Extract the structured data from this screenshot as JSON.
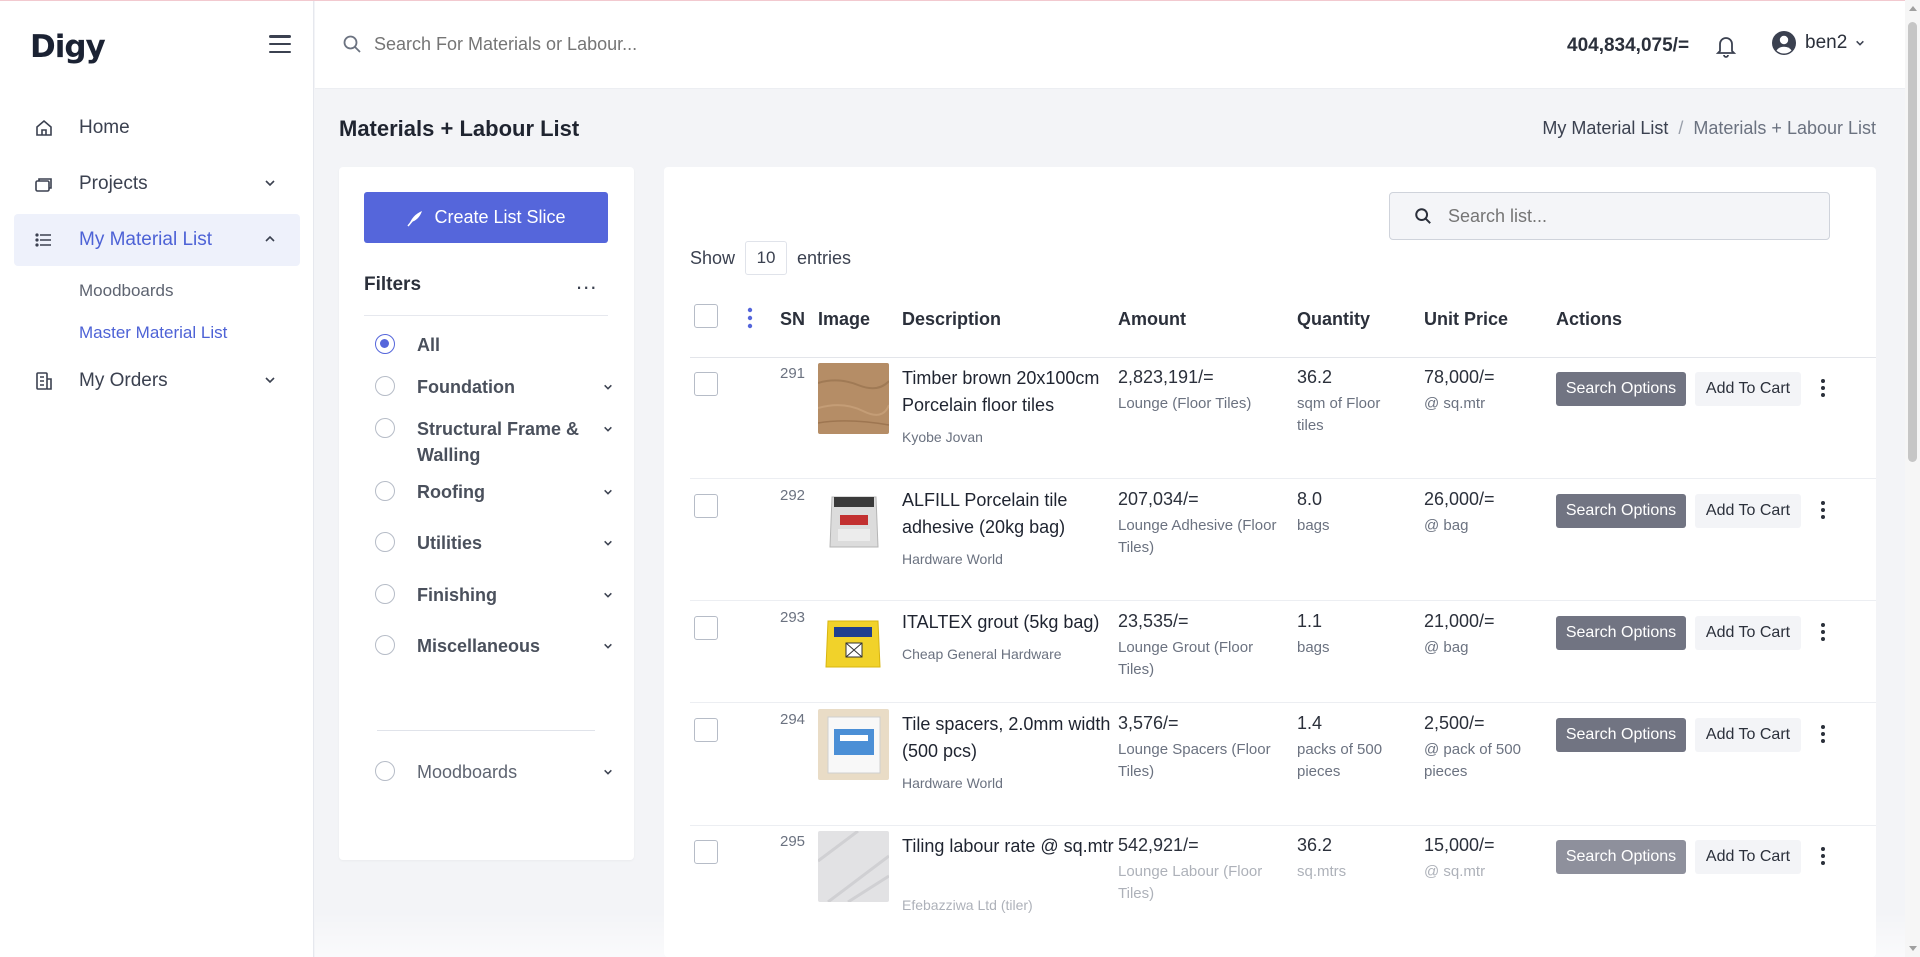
{
  "app": {
    "logo": "Digy"
  },
  "sidebar": {
    "items": [
      {
        "label": "Home",
        "icon": "home-icon"
      },
      {
        "label": "Projects",
        "icon": "projects-icon"
      },
      {
        "label": "My Material List",
        "icon": "list-icon",
        "active": true
      },
      {
        "label": "My Orders",
        "icon": "orders-icon"
      }
    ],
    "subitems": [
      {
        "label": "Moodboards"
      },
      {
        "label": "Master Material List",
        "active": true
      }
    ]
  },
  "header": {
    "search_placeholder": "Search For Materials or Labour...",
    "balance": "404,834,075/=",
    "username": "ben2"
  },
  "page": {
    "title": "Materials + Labour List",
    "breadcrumb": [
      "My Material List",
      "/",
      "Materials + Labour List"
    ]
  },
  "filters": {
    "create_label": "Create List Slice",
    "title": "Filters",
    "more": "...",
    "options": [
      {
        "label": "All",
        "checked": true
      },
      {
        "label": "Foundation"
      },
      {
        "label": "Structural Frame & Walling"
      },
      {
        "label": "Roofing"
      },
      {
        "label": "Utilities"
      },
      {
        "label": "Finishing"
      },
      {
        "label": "Miscellaneous"
      }
    ],
    "moodboards_label": "Moodboards"
  },
  "table": {
    "search_placeholder": "Search list...",
    "show_label": "Show",
    "entries_value": "10",
    "entries_label": "entries",
    "columns": [
      "SN",
      "Image",
      "Description",
      "Amount",
      "Quantity",
      "Unit Price",
      "Actions"
    ],
    "rows": [
      {
        "sn": "291",
        "description": "Timber brown 20x100cm Porcelain floor tiles",
        "vendor": "Kyobe Jovan",
        "amount": "2,823,191/=",
        "amount_note": "Lounge (Floor Tiles)",
        "quantity": "36.2",
        "quantity_unit": "sqm of Floor tiles",
        "unit_price": "78,000/=",
        "unit_price_note": "@ sq.mtr"
      },
      {
        "sn": "292",
        "description": "ALFILL Porcelain tile adhesive (20kg bag)",
        "vendor": "Hardware World",
        "amount": "207,034/=",
        "amount_note": "Lounge Adhesive (Floor Tiles)",
        "quantity": "8.0",
        "quantity_unit": "bags",
        "unit_price": "26,000/=",
        "unit_price_note": "@ bag"
      },
      {
        "sn": "293",
        "description": "ITALTEX grout (5kg bag)",
        "vendor": "Cheap General Hardware",
        "amount": "23,535/=",
        "amount_note": "Lounge Grout (Floor Tiles)",
        "quantity": "1.1",
        "quantity_unit": "bags",
        "unit_price": "21,000/=",
        "unit_price_note": "@ bag"
      },
      {
        "sn": "294",
        "description": "Tile spacers, 2.0mm width (500 pcs)",
        "vendor": "Hardware World",
        "amount": "3,576/=",
        "amount_note": "Lounge Spacers (Floor Tiles)",
        "quantity": "1.4",
        "quantity_unit": "packs of 500 pieces",
        "unit_price": "2,500/=",
        "unit_price_note": "@ pack of 500 pieces"
      },
      {
        "sn": "295",
        "description": "Tiling labour rate @ sq.mtr",
        "vendor": "Efebazziwa Ltd (tiler)",
        "amount": "542,921/=",
        "amount_note": "Lounge Labour (Floor Tiles)",
        "quantity": "36.2",
        "quantity_unit": "sq.mtrs",
        "unit_price": "15,000/=",
        "unit_price_note": "@ sq.mtr"
      }
    ],
    "search_options_label": "Search Options",
    "add_to_cart_label": "Add To Cart"
  },
  "colors": {
    "accent": "#5566db",
    "nav_active_bg": "#eef1fb",
    "search_options_bg": "#717482"
  }
}
